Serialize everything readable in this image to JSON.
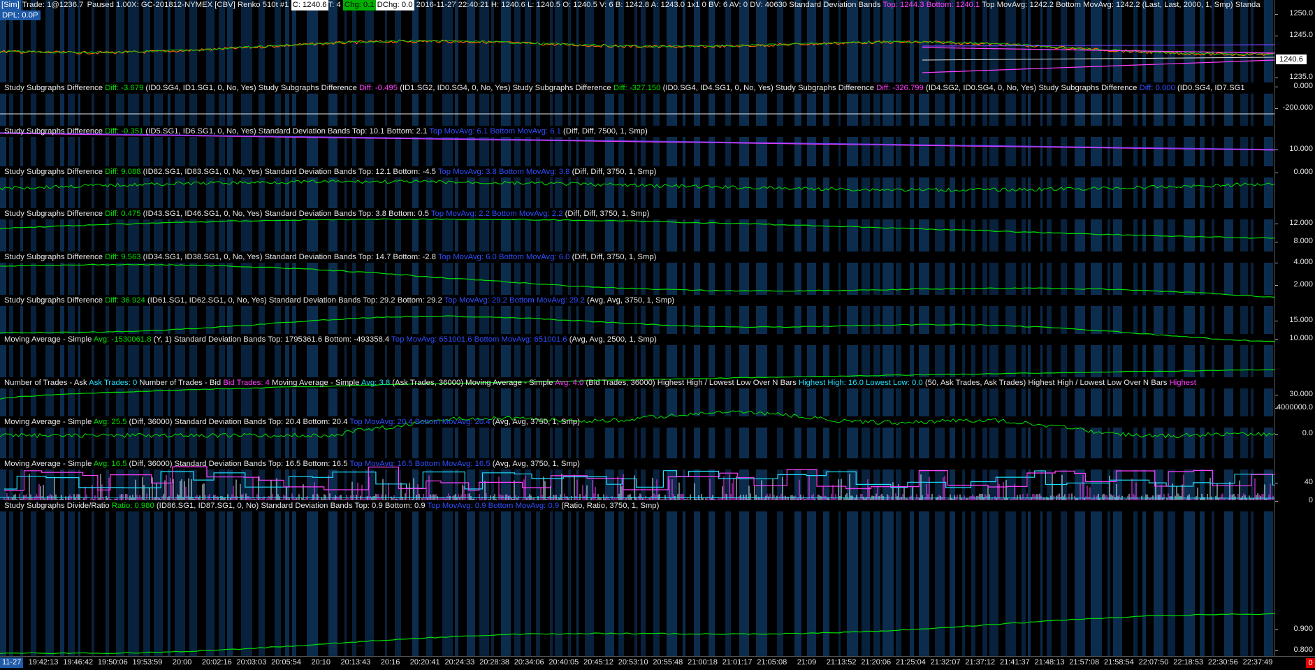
{
  "header": {
    "sim": "[Sim]",
    "trade": "Trade: 1@1236.7",
    "status": "Paused 1.00X: GC-201812-NYMEX [CBV]  Renko 510t  #1",
    "c": "C: 1240.6",
    "t": "T: 4",
    "chg": "Chg: 0.1",
    "dchg": "DChg: 0.0",
    "info": "2016-11-27 22:40:21 H: 1240.6 L: 1240.5 O: 1240.5 V: 6 B: 1242.8 A: 1243.0 1x1 0 BV: 6 AV: 0 DV: 40630 Standard Deviation Bands",
    "top": "Top: 1244.3",
    "bottom": "Bottom: 1240.1",
    "rest": "Top MovAvg: 1242.2  Bottom MovAvg: 1242.2   (Last, Last, 2000, 1, Smp)   Standa",
    "dpl": "DPL: 0.0P",
    "price_box": "1240.6"
  },
  "panes": [
    {
      "title": [
        [
          "w",
          "Study Subgraphs Difference "
        ],
        [
          "g",
          "Diff: -3.679"
        ],
        [
          "w",
          " (ID0.SG4, ID1.SG1, 0, No, Yes)  Study Subgraphs Difference "
        ],
        [
          "m",
          "Diff: -0.495"
        ],
        [
          "w",
          " (ID1.SG2, ID0.SG4, 0, No, Yes)  Study Subgraphs Difference "
        ],
        [
          "g",
          "Diff: -327.150"
        ],
        [
          "w",
          " (ID0.SG4, ID4.SG1, 0, No, Yes)  Study Subgraphs Difference "
        ],
        [
          "m",
          "Diff: -326.799"
        ],
        [
          "w",
          " (ID4.SG2, ID0.SG4, 0, No, Yes)  Study Subgraphs Difference "
        ],
        [
          "b",
          "Diff: 0.000"
        ],
        [
          "w",
          " (ID0.SG4, ID7.SG1"
        ]
      ]
    },
    {
      "title": [
        [
          "w",
          "Study Subgraphs Difference "
        ],
        [
          "g",
          "Diff: -0.351"
        ],
        [
          "w",
          " (ID5.SG1, ID6.SG1, 0, No, Yes)  Standard Deviation Bands  Top: 10.1  Bottom: 2.1 "
        ],
        [
          "b",
          "Top MovAvg: 6.1  Bottom MovAvg: 6.1"
        ],
        [
          "w",
          " (Diff, Diff, 7500, 1, Smp)"
        ]
      ]
    },
    {
      "title": [
        [
          "w",
          "Study Subgraphs Difference "
        ],
        [
          "g",
          "Diff: 9.088"
        ],
        [
          "w",
          " (ID82.SG1, ID83.SG1, 0, No, Yes)  Standard Deviation Bands  Top: 12.1  Bottom: -4.5 "
        ],
        [
          "b",
          "Top MovAvg: 3.8  Bottom MovAvg: 3.8"
        ],
        [
          "w",
          " (Diff, Diff, 3750, 1, Smp)"
        ]
      ]
    },
    {
      "title": [
        [
          "w",
          "Study Subgraphs Difference "
        ],
        [
          "g",
          "Diff: 0.475"
        ],
        [
          "w",
          " (ID43.SG1, ID46.SG1, 0, No, Yes)  Standard Deviation Bands  Top: 3.8  Bottom: 0.5 "
        ],
        [
          "b",
          "Top MovAvg: 2.2  Bottom MovAvg: 2.2"
        ],
        [
          "w",
          " (Diff, Diff, 3750, 1, Smp)"
        ]
      ]
    },
    {
      "title": [
        [
          "w",
          "Study Subgraphs Difference "
        ],
        [
          "g",
          "Diff: 9.563"
        ],
        [
          "w",
          " (ID34.SG1, ID38.SG1, 0, No, Yes)  Standard Deviation Bands  Top: 14.7  Bottom: -2.8 "
        ],
        [
          "b",
          "Top MovAvg: 6.0  Bottom MovAvg: 6.0"
        ],
        [
          "w",
          " (Diff, Diff, 3750, 1, Smp)"
        ]
      ]
    },
    {
      "title": [
        [
          "w",
          "Study Subgraphs Difference "
        ],
        [
          "g",
          "Diff: 36.924"
        ],
        [
          "w",
          " (ID61.SG1, ID62.SG1, 0, No, Yes)  Standard Deviation Bands  Top: 29.2  Bottom: 29.2 "
        ],
        [
          "b",
          "Top MovAvg: 29.2  Bottom MovAvg: 29.2"
        ],
        [
          "w",
          " (Avg, Avg, 3750, 1, Smp)"
        ]
      ]
    },
    {
      "title": [
        [
          "w",
          "Moving Average - Simple "
        ],
        [
          "g",
          "Avg: -1530061.8"
        ],
        [
          "w",
          " (Y, 1)  Standard Deviation Bands  Top: 1795361.6  Bottom: -493358.4 "
        ],
        [
          "b",
          "Top MovAvg: 651001.6  Bottom MovAvg: 651001.6"
        ],
        [
          "w",
          " (Avg, Avg, 2500, 1, Smp)"
        ]
      ]
    },
    {
      "title": [
        [
          "w",
          "Number of Trades - Ask "
        ],
        [
          "c",
          "Ask Trades: 0"
        ],
        [
          "w",
          " Number of Trades - Bid "
        ],
        [
          "m",
          "Bid Trades: 4"
        ],
        [
          "w",
          " Moving Average - Simple "
        ],
        [
          "c",
          "Avg: 3.8"
        ],
        [
          "w",
          " (Ask Trades, 36000)  Moving Average - Simple "
        ],
        [
          "m",
          "Avg: 4.0"
        ],
        [
          "w",
          " (Bid Trades, 36000)  Highest High / Lowest Low Over N Bars "
        ],
        [
          "c",
          "Highest High: 16.0  Lowest Low: 0.0"
        ],
        [
          "w",
          " (50, Ask Trades, Ask Trades)  Highest High / Lowest Low Over N Bars "
        ],
        [
          "m",
          "Highest"
        ]
      ]
    },
    {
      "title": [
        [
          "w",
          "Moving Average - Simple "
        ],
        [
          "g",
          "Avg: 25.5"
        ],
        [
          "w",
          " (Diff, 36000)  Standard Deviation Bands  Top: 20.4  Bottom: 20.4 "
        ],
        [
          "b",
          "Top MovAvg: 20.4  Bottom MovAvg: 20.4"
        ],
        [
          "w",
          " (Avg, Avg, 3750, 1, Smp)"
        ]
      ]
    },
    {
      "title": [
        [
          "w",
          "Moving Average - Simple "
        ],
        [
          "g",
          "Avg: 16.5"
        ],
        [
          "w",
          " (Diff, 36000)  Standard Deviation Bands  Top: 16.5  Bottom: 16.5 "
        ],
        [
          "b",
          "Top MovAvg: 16.5  Bottom MovAvg: 16.5"
        ],
        [
          "w",
          " (Avg, Avg, 3750, 1, Smp)"
        ]
      ]
    },
    {
      "title": [
        [
          "w",
          "Study Subgraphs Divide/Ratio "
        ],
        [
          "g",
          "Ratio: 0.980"
        ],
        [
          "w",
          " (ID86.SG1, ID87.SG1, 0, No)  Standard Deviation Bands  Top: 0.9  Bottom: 0.9 "
        ],
        [
          "b",
          "Top MovAvg: 0.9  Bottom MovAvg: 0.9"
        ],
        [
          "w",
          " (Ratio, Ratio, 3750, 1, Smp)"
        ]
      ]
    }
  ],
  "right_scale": [
    {
      "label": "1250.0",
      "pane": 0,
      "frac": 0.17
    },
    {
      "label": "1245.0",
      "pane": 0,
      "frac": 0.43
    },
    {
      "label": "1235.0",
      "pane": 0,
      "frac": 0.94
    },
    {
      "label": "0.000",
      "pane": 1,
      "frac": 0.1
    },
    {
      "label": "-200.000",
      "pane": 1,
      "frac": 0.6
    },
    {
      "label": "10.000",
      "pane": 2,
      "frac": 0.3
    },
    {
      "label": "0.000",
      "pane": 2,
      "frac": 0.85
    },
    {
      "label": "12.000",
      "pane": 3,
      "frac": 0.32
    },
    {
      "label": "8.000",
      "pane": 3,
      "frac": 0.74
    },
    {
      "label": "4.000",
      "pane": 4,
      "frac": 0.23
    },
    {
      "label": "2.000",
      "pane": 4,
      "frac": 0.68
    },
    {
      "label": "15.000",
      "pane": 5,
      "frac": 0.3
    },
    {
      "label": "10.000",
      "pane": 5,
      "frac": 0.73
    },
    {
      "label": "30.000",
      "pane": 6,
      "frac": 0.74
    },
    {
      "label": "4000000.0",
      "pane": 7,
      "frac": 0.06
    },
    {
      "label": "0.0",
      "pane": 7,
      "frac": 0.66
    },
    {
      "label": "40",
      "pane": 8,
      "frac": 0.42
    },
    {
      "label": "0",
      "pane": 8,
      "frac": 0.98
    },
    {
      "label": "0.900",
      "pane": 11,
      "frac": 0.44
    },
    {
      "label": "0.800",
      "pane": 11,
      "frac": 0.9
    }
  ],
  "time_axis": {
    "date": "11-27",
    "labels": [
      "19:42:13",
      "19:46:42",
      "19:50:06",
      "19:53:59",
      "20:00",
      "20:02:16",
      "20:03:03",
      "20:05:54",
      "20:10",
      "20:13:43",
      "20:16",
      "20:20:41",
      "20:24:33",
      "20:28:38",
      "20:34:06",
      "20:40:05",
      "20:45:12",
      "20:53:10",
      "20:55:48",
      "21:00:18",
      "21:01:17",
      "21:05:08",
      "21:09",
      "21:13:52",
      "21:20:06",
      "21:25:04",
      "21:32:07",
      "21:37:12",
      "21:41:37",
      "21:48:13",
      "21:57:08",
      "21:58:54",
      "22:07:50",
      "22:18:53",
      "22:30:56",
      "22:37:49"
    ]
  },
  "colors": {
    "bg": "#000000",
    "band": "#0b2a4a",
    "green": "#00e000",
    "magenta": "#ff40ff",
    "blue": "#2f4fff",
    "cyan": "#20e0ff",
    "white": "#e8e8e8"
  },
  "corner": "0"
}
